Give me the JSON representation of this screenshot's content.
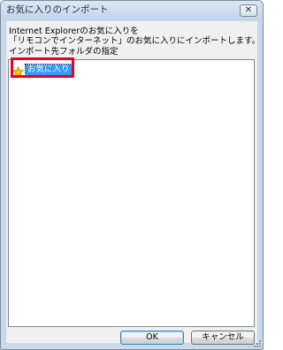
{
  "window": {
    "title": "お気に入りのインポート",
    "close_label": "✕"
  },
  "description": {
    "line1": "Internet Explorerのお気に入りを",
    "line2": "「リモコンでインターネット」のお気に入りにインポートします。"
  },
  "folder_label": "インポート先フォルダの指定",
  "tree": {
    "items": [
      {
        "label": "お気に入り",
        "icon": "star-icon",
        "selected": true
      }
    ]
  },
  "buttons": {
    "ok_label": "OK",
    "cancel_label": "キャンセル"
  },
  "colors": {
    "highlight_box": "#e8001c",
    "selection": "#3399ff",
    "star": "#f5c400"
  }
}
